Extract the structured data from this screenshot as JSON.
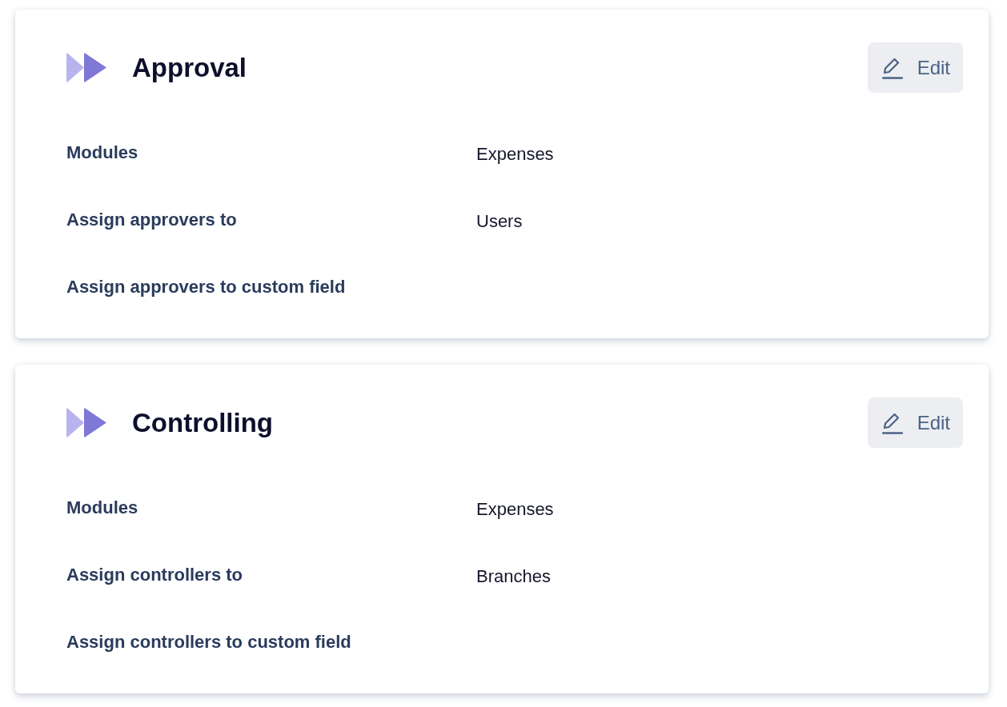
{
  "sections": [
    {
      "title": "Approval",
      "edit_button": "Edit",
      "rows": [
        {
          "label": "Modules",
          "value": "Expenses"
        },
        {
          "label": "Assign approvers to",
          "value": "Users"
        },
        {
          "label": "Assign approvers to custom field"
        }
      ]
    },
    {
      "title": "Controlling",
      "edit_button": "Edit",
      "rows": [
        {
          "label": "Modules",
          "value": "Expenses"
        },
        {
          "label": "Assign controllers to",
          "value": "Branches"
        },
        {
          "label": "Assign controllers to custom field"
        }
      ]
    }
  ]
}
